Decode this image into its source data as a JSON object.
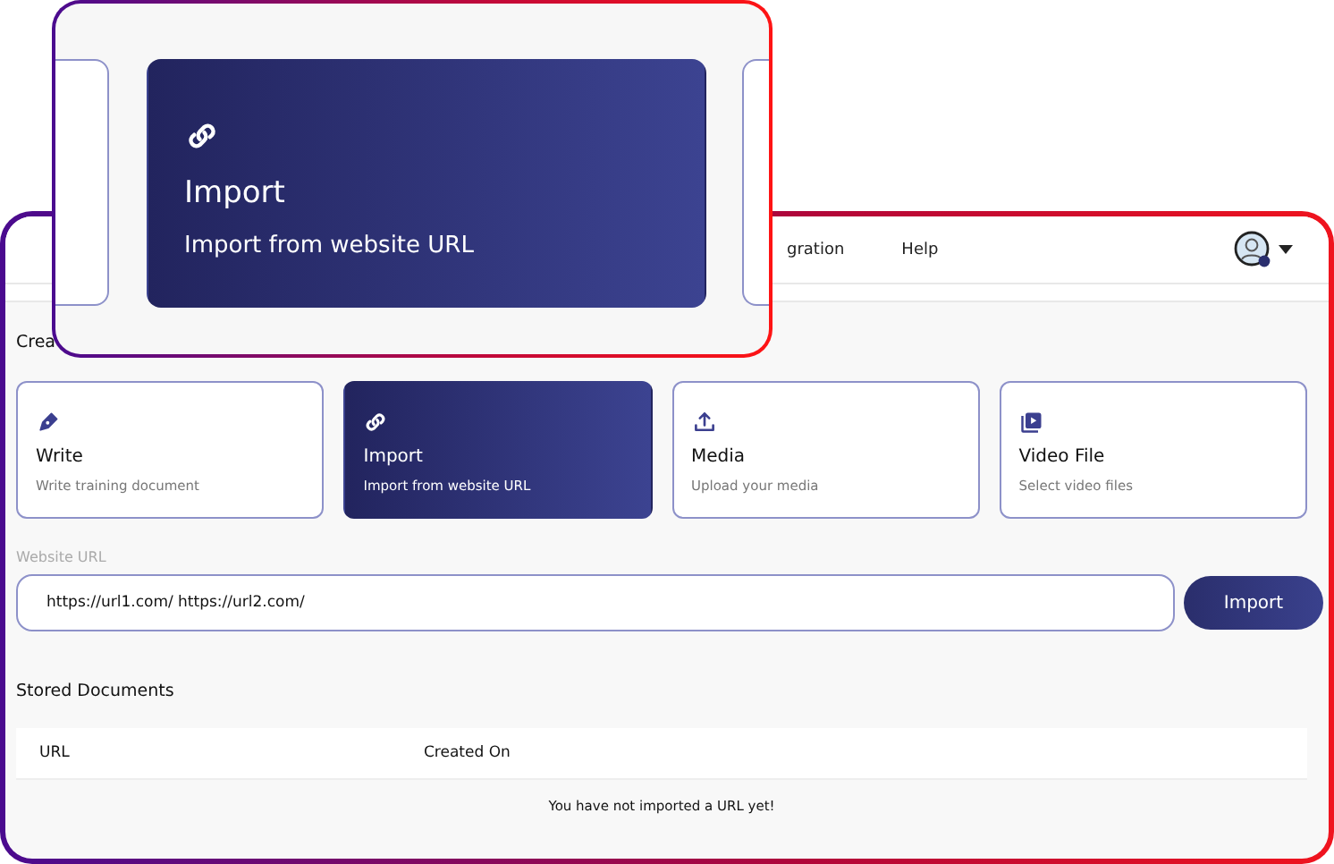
{
  "app_window": {
    "nav": [
      {
        "label": "gration"
      },
      {
        "label": "Help"
      }
    ],
    "section_title": "Crea",
    "sources": [
      {
        "kind": "write",
        "title": "Write",
        "description": "Write training document",
        "selected": false
      },
      {
        "kind": "import",
        "title": "Import",
        "description": "Import from website URL",
        "selected": true
      },
      {
        "kind": "media",
        "title": "Media",
        "description": "Upload your media",
        "selected": false
      },
      {
        "kind": "video",
        "title": "Video File",
        "description": "Select video files",
        "selected": false
      }
    ],
    "url_field": {
      "label": "Website URL",
      "value": "https://url1.com/ https://url2.com/"
    },
    "import_button": "Import",
    "stored_title": "Stored Documents",
    "table": {
      "columns": [
        "URL",
        "Created On"
      ],
      "empty_message": "You have not imported a URL yet!"
    }
  },
  "zoom_callout": {
    "card": {
      "kind": "import",
      "title": "Import",
      "description": "Import from website URL",
      "selected": true
    }
  }
}
